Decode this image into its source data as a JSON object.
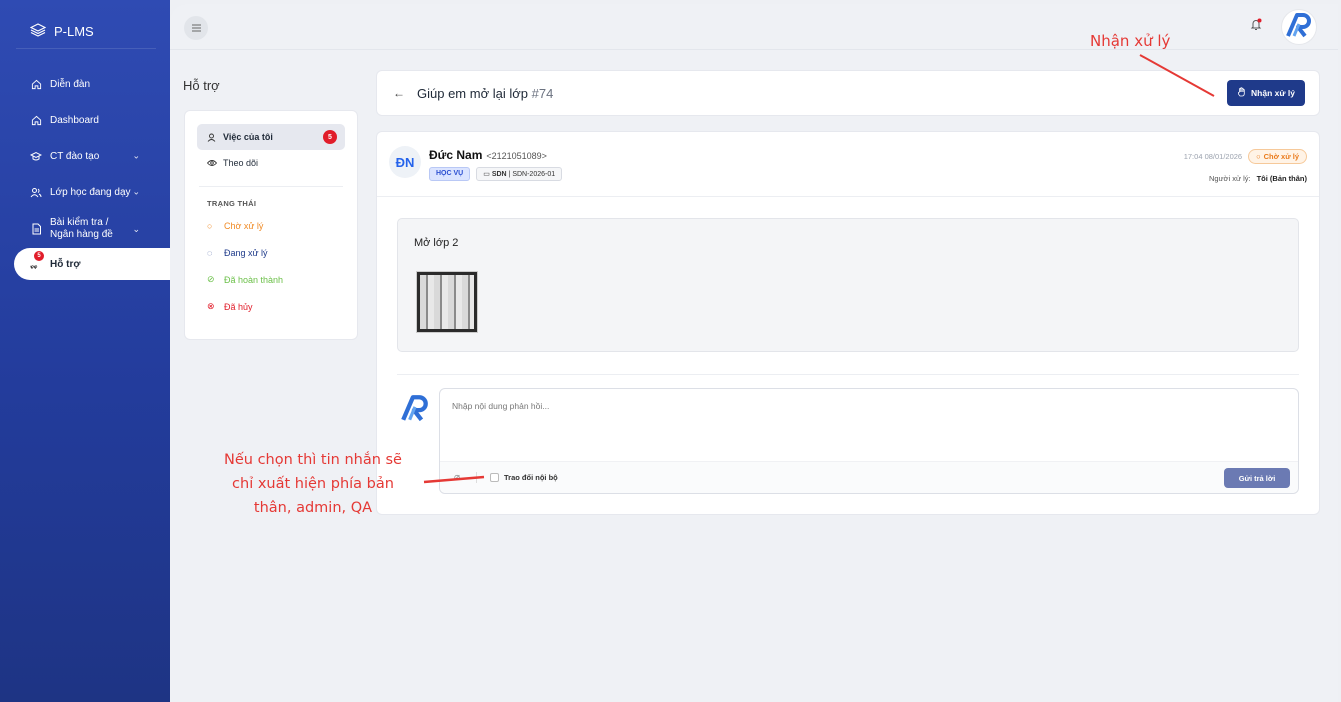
{
  "app": {
    "name": "P-LMS"
  },
  "sidebar": {
    "items": [
      {
        "label": "Diễn đàn",
        "icon": "home-icon"
      },
      {
        "label": "Dashboard",
        "icon": "home-icon"
      },
      {
        "label": "CT đào tạo",
        "icon": "graduation-cap-icon"
      },
      {
        "label": "Lớp học đang dạy",
        "icon": "users-icon"
      },
      {
        "label_line1": "Bài kiểm tra /",
        "label_line2": "Ngân hàng đề",
        "icon": "document-icon"
      },
      {
        "label": "Hỗ trợ",
        "icon": "support-icon",
        "badge": "5"
      }
    ]
  },
  "page": {
    "title": "Hỗ trợ"
  },
  "filters": {
    "my_work": {
      "label": "Việc của tôi",
      "badge": "5"
    },
    "following": {
      "label": "Theo dõi"
    },
    "status_group": "TRẠNG THÁI",
    "statuses": [
      {
        "label": "Chờ xử lý",
        "color": "#f08a24"
      },
      {
        "label": "Đang xử lý",
        "color": "#1e3a8a"
      },
      {
        "label": "Đã hoàn thành",
        "color": "#6cc04a"
      },
      {
        "label": "Đã hủy",
        "color": "#e11d2a"
      }
    ]
  },
  "ticket": {
    "title": "Giúp em mở lại lớp",
    "number": "#74",
    "claim_label": "Nhận xử lý",
    "author_initials": "ĐN",
    "author_name": "Đức Nam",
    "author_code": "<2121051089>",
    "tag_category": "HỌC VỤ",
    "tag_course": "SDN",
    "tag_class": "SDN-2026-01",
    "time": "17:04 08/01/2026",
    "status": "Chờ xử lý",
    "handler_label": "Người xử lý:",
    "handler_value": "Tôi (Bản thân)",
    "message": "Mở lớp 2"
  },
  "reply": {
    "placeholder": "Nhập nội dung phản hồi...",
    "internal_label": "Trao đổi nội bộ",
    "send_label": "Gửi trả lời"
  },
  "annotations": {
    "claim_note": "Nhận xử lý",
    "internal_note_line1": "Nếu chọn thì tin nhắn sẽ",
    "internal_note_line2": "chỉ xuất hiện phía bản",
    "internal_note_line3": "thân, admin, QA"
  },
  "colors": {
    "sidebar": "#2a45a8",
    "primary": "#1f3a8a",
    "annotation": "#e53935",
    "pending": "#ea7b1c"
  }
}
